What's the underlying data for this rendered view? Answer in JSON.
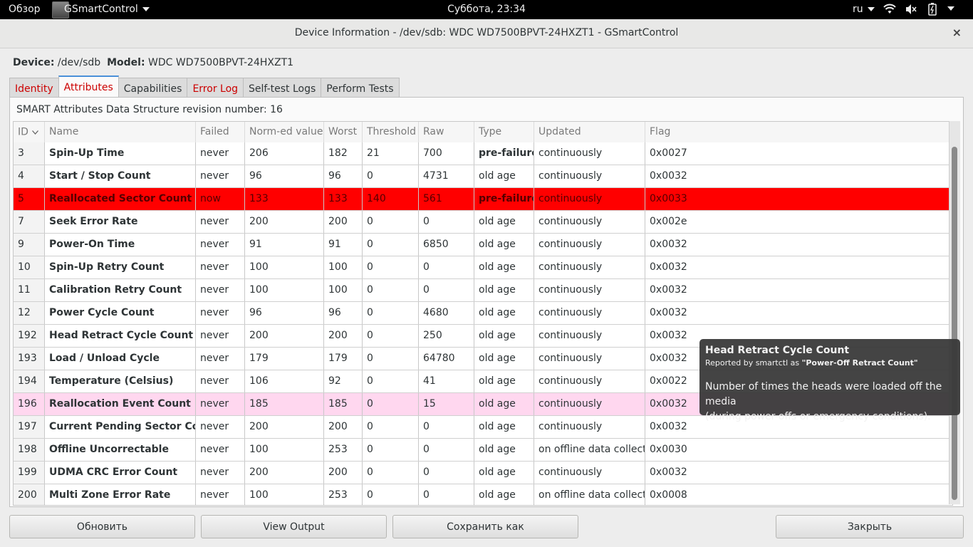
{
  "topbar": {
    "overview": "Обзор",
    "app_menu": "GSmartControl",
    "clock": "Суббота, 23:34",
    "lang": "ru"
  },
  "window": {
    "title": "Device Information - /dev/sdb: WDC WD7500BPVT-24HXZT1 - GSmartControl",
    "close": "×"
  },
  "device": {
    "device_label": "Device:",
    "device_value": "/dev/sdb",
    "model_label": "Model:",
    "model_value": "WDC WD7500BPVT-24HXZT1"
  },
  "tabs": [
    "Identity",
    "Attributes",
    "Capabilities",
    "Error Log",
    "Self-test Logs",
    "Perform Tests"
  ],
  "attributes": {
    "revision_text": "SMART Attributes Data Structure revision number: 16",
    "columns": [
      "ID",
      "Name",
      "Failed",
      "Norm-ed value",
      "Worst",
      "Threshold",
      "Raw value",
      "Type",
      "Updated",
      "Flag"
    ],
    "rows": [
      {
        "id": "3",
        "name": "Spin-Up Time",
        "failed": "never",
        "norm": "206",
        "worst": "182",
        "thr": "21",
        "raw": "700",
        "type": "pre-failure",
        "updated": "continuously",
        "flag": "0x0027",
        "state": "normal"
      },
      {
        "id": "4",
        "name": "Start / Stop Count",
        "failed": "never",
        "norm": "96",
        "worst": "96",
        "thr": "0",
        "raw": "4731",
        "type": "old age",
        "updated": "continuously",
        "flag": "0x0032",
        "state": "normal"
      },
      {
        "id": "5",
        "name": "Reallocated Sector Count",
        "failed": "now",
        "norm": "133",
        "worst": "133",
        "thr": "140",
        "raw": "561",
        "type": "pre-failure",
        "updated": "continuously",
        "flag": "0x0033",
        "state": "fail"
      },
      {
        "id": "7",
        "name": "Seek Error Rate",
        "failed": "never",
        "norm": "200",
        "worst": "200",
        "thr": "0",
        "raw": "0",
        "type": "old age",
        "updated": "continuously",
        "flag": "0x002e",
        "state": "normal"
      },
      {
        "id": "9",
        "name": "Power-On Time",
        "failed": "never",
        "norm": "91",
        "worst": "91",
        "thr": "0",
        "raw": "6850",
        "type": "old age",
        "updated": "continuously",
        "flag": "0x0032",
        "state": "normal"
      },
      {
        "id": "10",
        "name": "Spin-Up Retry Count",
        "failed": "never",
        "norm": "100",
        "worst": "100",
        "thr": "0",
        "raw": "0",
        "type": "old age",
        "updated": "continuously",
        "flag": "0x0032",
        "state": "normal"
      },
      {
        "id": "11",
        "name": "Calibration Retry Count",
        "failed": "never",
        "norm": "100",
        "worst": "100",
        "thr": "0",
        "raw": "0",
        "type": "old age",
        "updated": "continuously",
        "flag": "0x0032",
        "state": "normal"
      },
      {
        "id": "12",
        "name": "Power Cycle Count",
        "failed": "never",
        "norm": "96",
        "worst": "96",
        "thr": "0",
        "raw": "4680",
        "type": "old age",
        "updated": "continuously",
        "flag": "0x0032",
        "state": "normal"
      },
      {
        "id": "192",
        "name": "Head Retract Cycle Count",
        "failed": "never",
        "norm": "200",
        "worst": "200",
        "thr": "0",
        "raw": "250",
        "type": "old age",
        "updated": "continuously",
        "flag": "0x0032",
        "state": "normal"
      },
      {
        "id": "193",
        "name": "Load / Unload Cycle",
        "failed": "never",
        "norm": "179",
        "worst": "179",
        "thr": "0",
        "raw": "64780",
        "type": "old age",
        "updated": "continuously",
        "flag": "0x0032",
        "state": "normal"
      },
      {
        "id": "194",
        "name": "Temperature (Celsius)",
        "failed": "never",
        "norm": "106",
        "worst": "92",
        "thr": "0",
        "raw": "41",
        "type": "old age",
        "updated": "continuously",
        "flag": "0x0022",
        "state": "normal"
      },
      {
        "id": "196",
        "name": "Reallocation Event Count",
        "failed": "never",
        "norm": "185",
        "worst": "185",
        "thr": "0",
        "raw": "15",
        "type": "old age",
        "updated": "continuously",
        "flag": "0x0032",
        "state": "warn"
      },
      {
        "id": "197",
        "name": "Current Pending Sector Count",
        "failed": "never",
        "norm": "200",
        "worst": "200",
        "thr": "0",
        "raw": "0",
        "type": "old age",
        "updated": "continuously",
        "flag": "0x0032",
        "state": "normal"
      },
      {
        "id": "198",
        "name": "Offline Uncorrectable",
        "failed": "never",
        "norm": "100",
        "worst": "253",
        "thr": "0",
        "raw": "0",
        "type": "old age",
        "updated": "on offline data collect.",
        "flag": "0x0030",
        "state": "normal"
      },
      {
        "id": "199",
        "name": "UDMA CRC Error Count",
        "failed": "never",
        "norm": "200",
        "worst": "200",
        "thr": "0",
        "raw": "0",
        "type": "old age",
        "updated": "continuously",
        "flag": "0x0032",
        "state": "normal"
      },
      {
        "id": "200",
        "name": "Multi Zone Error Rate",
        "failed": "never",
        "norm": "100",
        "worst": "253",
        "thr": "0",
        "raw": "0",
        "type": "old age",
        "updated": "on offline data collect.",
        "flag": "0x0008",
        "state": "normal"
      }
    ]
  },
  "tooltip": {
    "title": "Head Retract Cycle Count",
    "source_prefix": "Reported by smartctl as ",
    "source_name": "\"Power-Off Retract Count\"",
    "desc_line1": "Number of times the heads were loaded off the media",
    "desc_line2": "(during power-offs or emergency conditions)."
  },
  "buttons": {
    "refresh": "Обновить",
    "view_output": "View Output",
    "save_as": "Сохранить как",
    "close": "Закрыть"
  },
  "colors": {
    "fail_row": "#ff0000",
    "warn_row": "#ffd7ef",
    "active_tab_accent": "#4a90d9",
    "error_tab_text": "#cc0000"
  }
}
